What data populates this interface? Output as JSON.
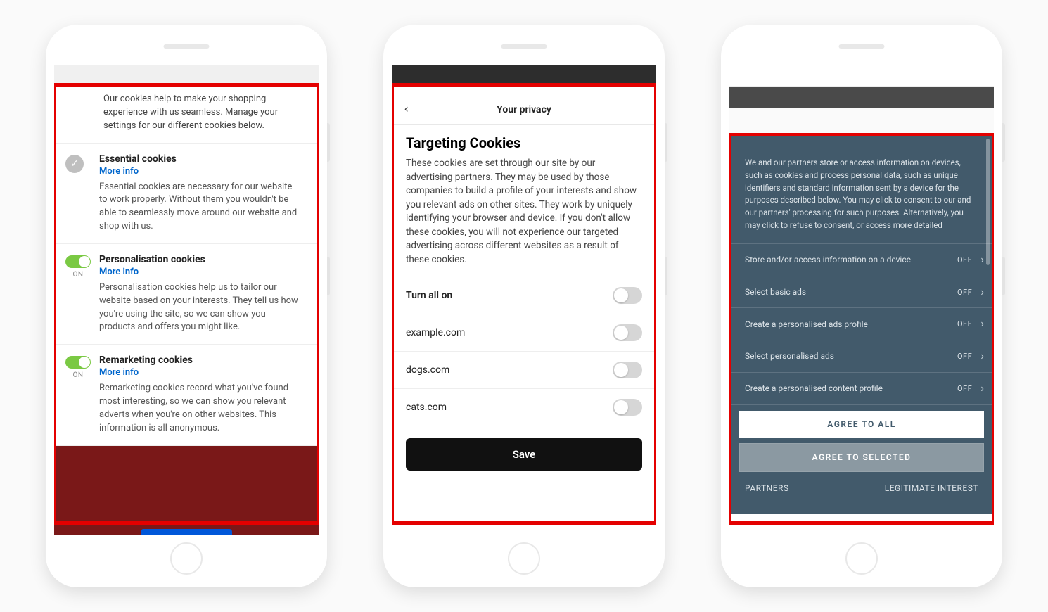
{
  "phone1": {
    "intro": "Our cookies help to make your shopping experience with us seamless. Manage your settings for our different cookies below.",
    "on_label": "ON",
    "sections": [
      {
        "title": "Essential cookies",
        "more_info": "More info",
        "desc": "Essential cookies are necessary for our website to work properly. Without them you wouldn't be able to seamlessly move around our website and shop with us."
      },
      {
        "title": "Personalisation cookies",
        "more_info": "More info",
        "desc": "Personalisation cookies help us to tailor our website based on your interests. They tell us how you're using the site, so we can show you products and offers you might like."
      },
      {
        "title": "Remarketing cookies",
        "more_info": "More info",
        "desc": "Remarketing cookies record what you've found most interesting, so we can show you relevant adverts when you're on other websites. This information is all anonymous."
      }
    ]
  },
  "phone2": {
    "header_title": "Your privacy",
    "heading": "Targeting Cookies",
    "desc": "These cookies are set through our site by our advertising partners. They may be used by those companies to build a profile of your interests and show you relevant ads on other sites. They work by uniquely identifying your browser and device. If you don't allow these cookies, you will not experience our targeted advertising across different websites as a result of these cookies.",
    "turn_all": "Turn all on",
    "rows": [
      "example.com",
      "dogs.com",
      "cats.com"
    ],
    "save": "Save"
  },
  "phone3": {
    "intro": "We and our partners store or access information on devices, such as cookies and process personal data, such as unique identifiers and standard information sent by a device for the purposes described below. You may click to consent to our and our partners' processing for such purposes. Alternatively, you may click to refuse to consent, or access more detailed",
    "off_label": "OFF",
    "items": [
      "Store and/or access information on a device",
      "Select basic ads",
      "Create a personalised ads profile",
      "Select personalised ads",
      "Create a personalised content profile"
    ],
    "agree_all": "AGREE TO ALL",
    "agree_selected": "AGREE TO SELECTED",
    "partners": "PARTNERS",
    "legitimate": "LEGITIMATE INTEREST"
  }
}
